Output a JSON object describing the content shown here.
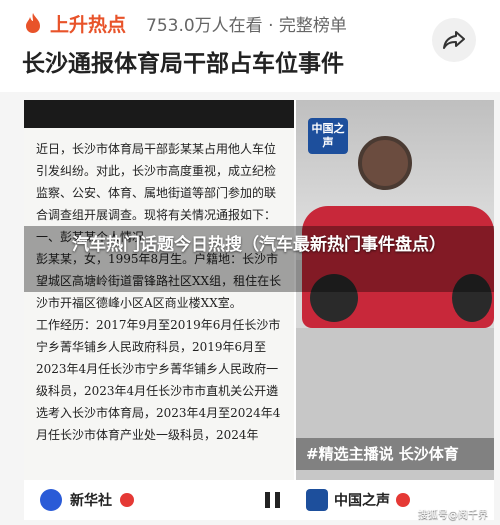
{
  "header": {
    "hot_label": "上升热点",
    "views": "753.0万人在看 · 完整榜单",
    "headline": "长沙通报体育局干部占车位事件"
  },
  "document": {
    "paragraphs": [
      "近日，长沙市体育局干部彭某某占用他人车位引发纠纷。对此，长沙市高度重视，成立纪检监察、公安、体育、属地街道等部门参加的联合调查组开展调查。现将有关情况通报如下：",
      "一、彭某某个人情况",
      "彭某某，女，1995年8月生。户籍地：长沙市望城区高塘岭街道雷锋路社区XX组，租住在长沙市开福区德峰小区A区商业楼XX室。",
      "工作经历：2017年9月至2019年6月任长沙市宁乡菁华铺乡人民政府科员，2019年6月至2023年4月任长沙市宁乡菁华铺乡人民政府一级科员，2023年4月任长沙市市直机关公开遴选考入长沙市体育局，2023年4月至2024年4月任长沙市体育产业处一级科员，2024年"
    ],
    "source_brand": "新华社"
  },
  "video": {
    "channel_logo": "中国之声",
    "caption": "#精选主播说  长沙体育",
    "source_brand": "中国之声"
  },
  "overlay": {
    "title": "汽车热门话题今日热搜（汽车最新热门事件盘点）"
  },
  "watermark": "搜狐号@阅千界"
}
